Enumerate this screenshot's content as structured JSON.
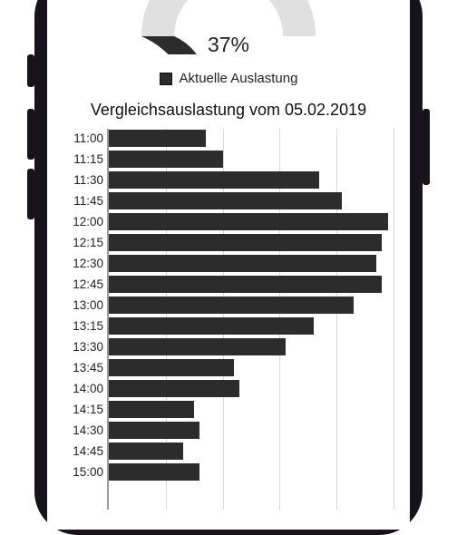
{
  "gauge": {
    "percent": 37,
    "percent_label": "37%"
  },
  "legend": {
    "current_label": "Aktuelle Auslastung"
  },
  "comparison_title": "Vergleichsauslastung vom 05.02.2019",
  "colors": {
    "bar": "#2c2c2c",
    "gauge_bg": "#e0e0e0",
    "gauge_fg": "#2c2c2c"
  },
  "chart_data": {
    "type": "bar",
    "orientation": "horizontal",
    "title": "Vergleichsauslastung vom 05.02.2019",
    "xlabel": "",
    "ylabel": "",
    "xlim": [
      0,
      100
    ],
    "categories": [
      "11:00",
      "11:15",
      "11:30",
      "11:45",
      "12:00",
      "12:15",
      "12:30",
      "12:45",
      "13:00",
      "13:15",
      "13:30",
      "13:45",
      "14:00",
      "14:15",
      "14:30",
      "14:45",
      "15:00"
    ],
    "values": [
      34,
      40,
      74,
      82,
      98,
      96,
      94,
      96,
      86,
      72,
      62,
      44,
      46,
      30,
      32,
      26,
      32
    ]
  }
}
